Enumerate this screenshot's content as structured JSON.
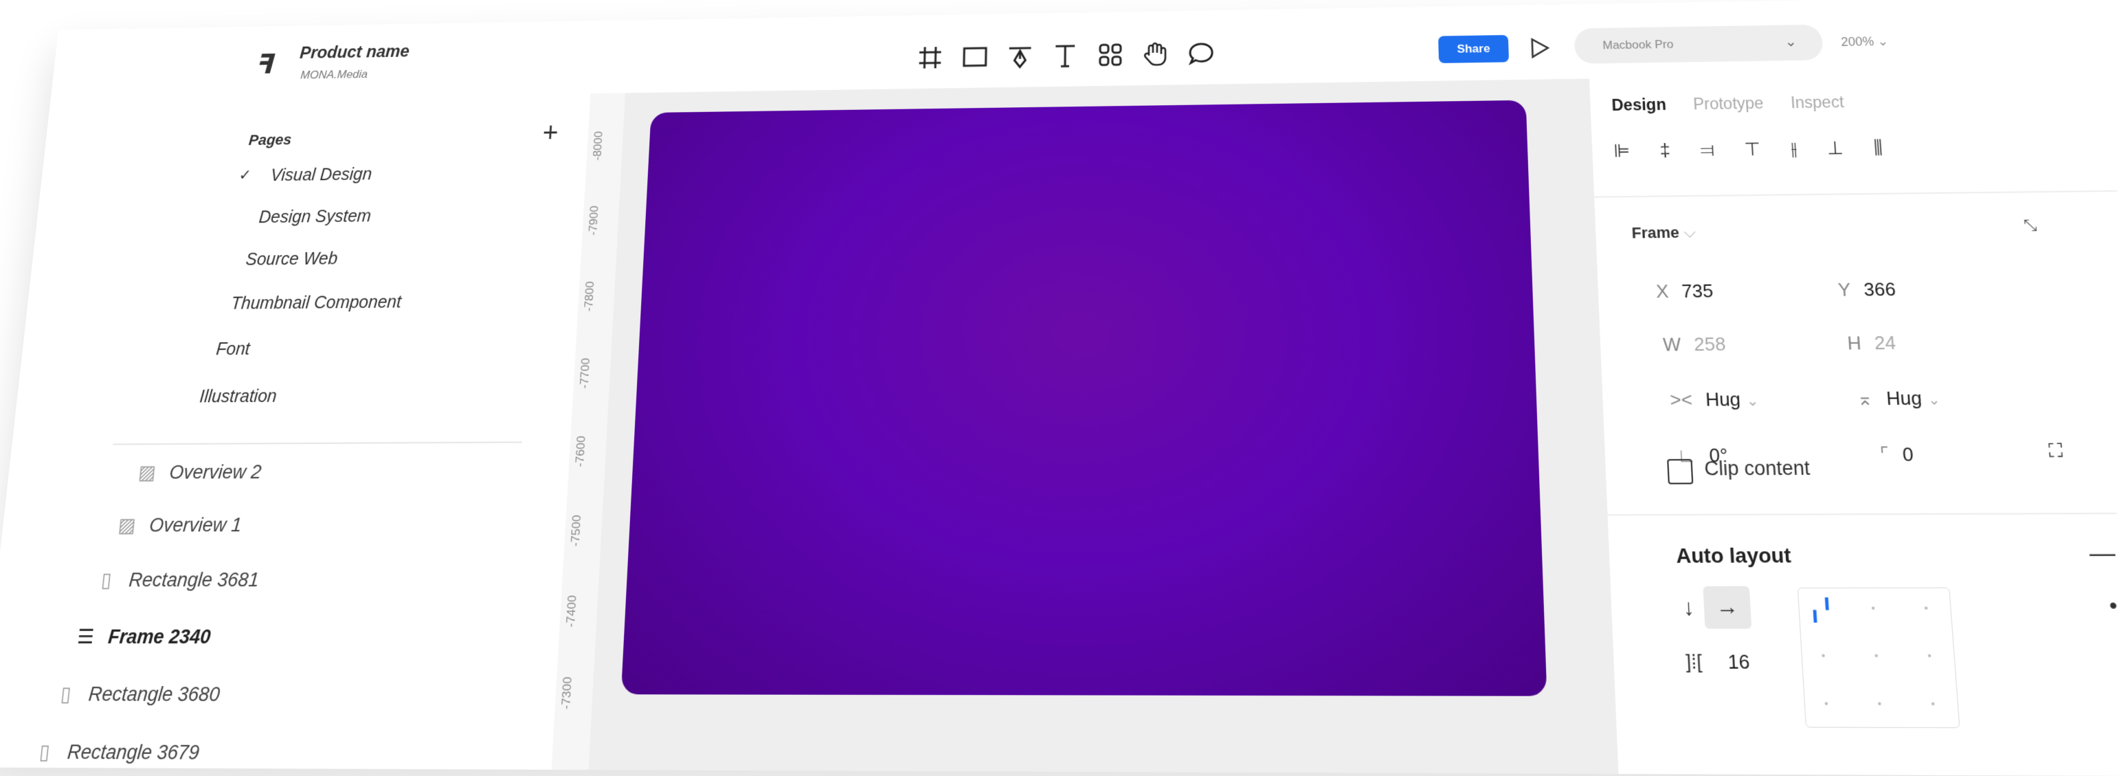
{
  "app": {
    "logo_glyph": "ꟻ",
    "project_name": "Product name",
    "team": "MONA.Media"
  },
  "toolbar": {
    "tools": [
      "frame-icon",
      "rectangle-icon",
      "pen-icon",
      "text-icon",
      "components-icon",
      "hand-icon",
      "comment-icon"
    ],
    "share_label": "Share",
    "device_label": "Macbook Pro",
    "zoom_label": "200%"
  },
  "pages": {
    "heading": "Pages",
    "add": "+",
    "items": [
      {
        "label": "Visual Design",
        "selected": true
      },
      {
        "label": "Design System"
      },
      {
        "label": "Source Web"
      },
      {
        "label": "Thumbnail Component"
      },
      {
        "label": "Font"
      },
      {
        "label": "Illustration"
      }
    ],
    "check": "✓"
  },
  "layers": [
    {
      "label": "Overview 2",
      "icon": "image-icon"
    },
    {
      "label": "Overview 1",
      "icon": "image-icon"
    },
    {
      "label": "Rectangle 3681",
      "icon": "rectangle-icon"
    },
    {
      "label": "Frame 2340",
      "icon": "autolayout-icon"
    },
    {
      "label": "Rectangle 3680",
      "icon": "rectangle-icon"
    },
    {
      "label": "Rectangle 3679",
      "icon": "rectangle-icon"
    }
  ],
  "ruler": [
    "-8000",
    "-7900",
    "-7800",
    "-7700",
    "-7600",
    "-7500",
    "-7400",
    "-7300"
  ],
  "canvas": {
    "frame_colors": [
      "#6a0aa8",
      "#5d05b4",
      "#4a0288"
    ]
  },
  "inspector": {
    "tabs": [
      "Design",
      "Prototype",
      "Inspect"
    ],
    "frame_heading": "Frame",
    "frame_caret": "⌵",
    "x_label": "X",
    "x_value": "735",
    "y_label": "Y",
    "y_value": "366",
    "w_label": "W",
    "w_value": "258",
    "h_label": "H",
    "h_value": "24",
    "hug_h": "Hug",
    "hug_v": "Hug",
    "rotation_value": "0°",
    "radius_value": "0",
    "clip_label": "Clip content",
    "autolayout_heading": "Auto layout",
    "autolayout_remove": "—",
    "gap_value": "16"
  }
}
